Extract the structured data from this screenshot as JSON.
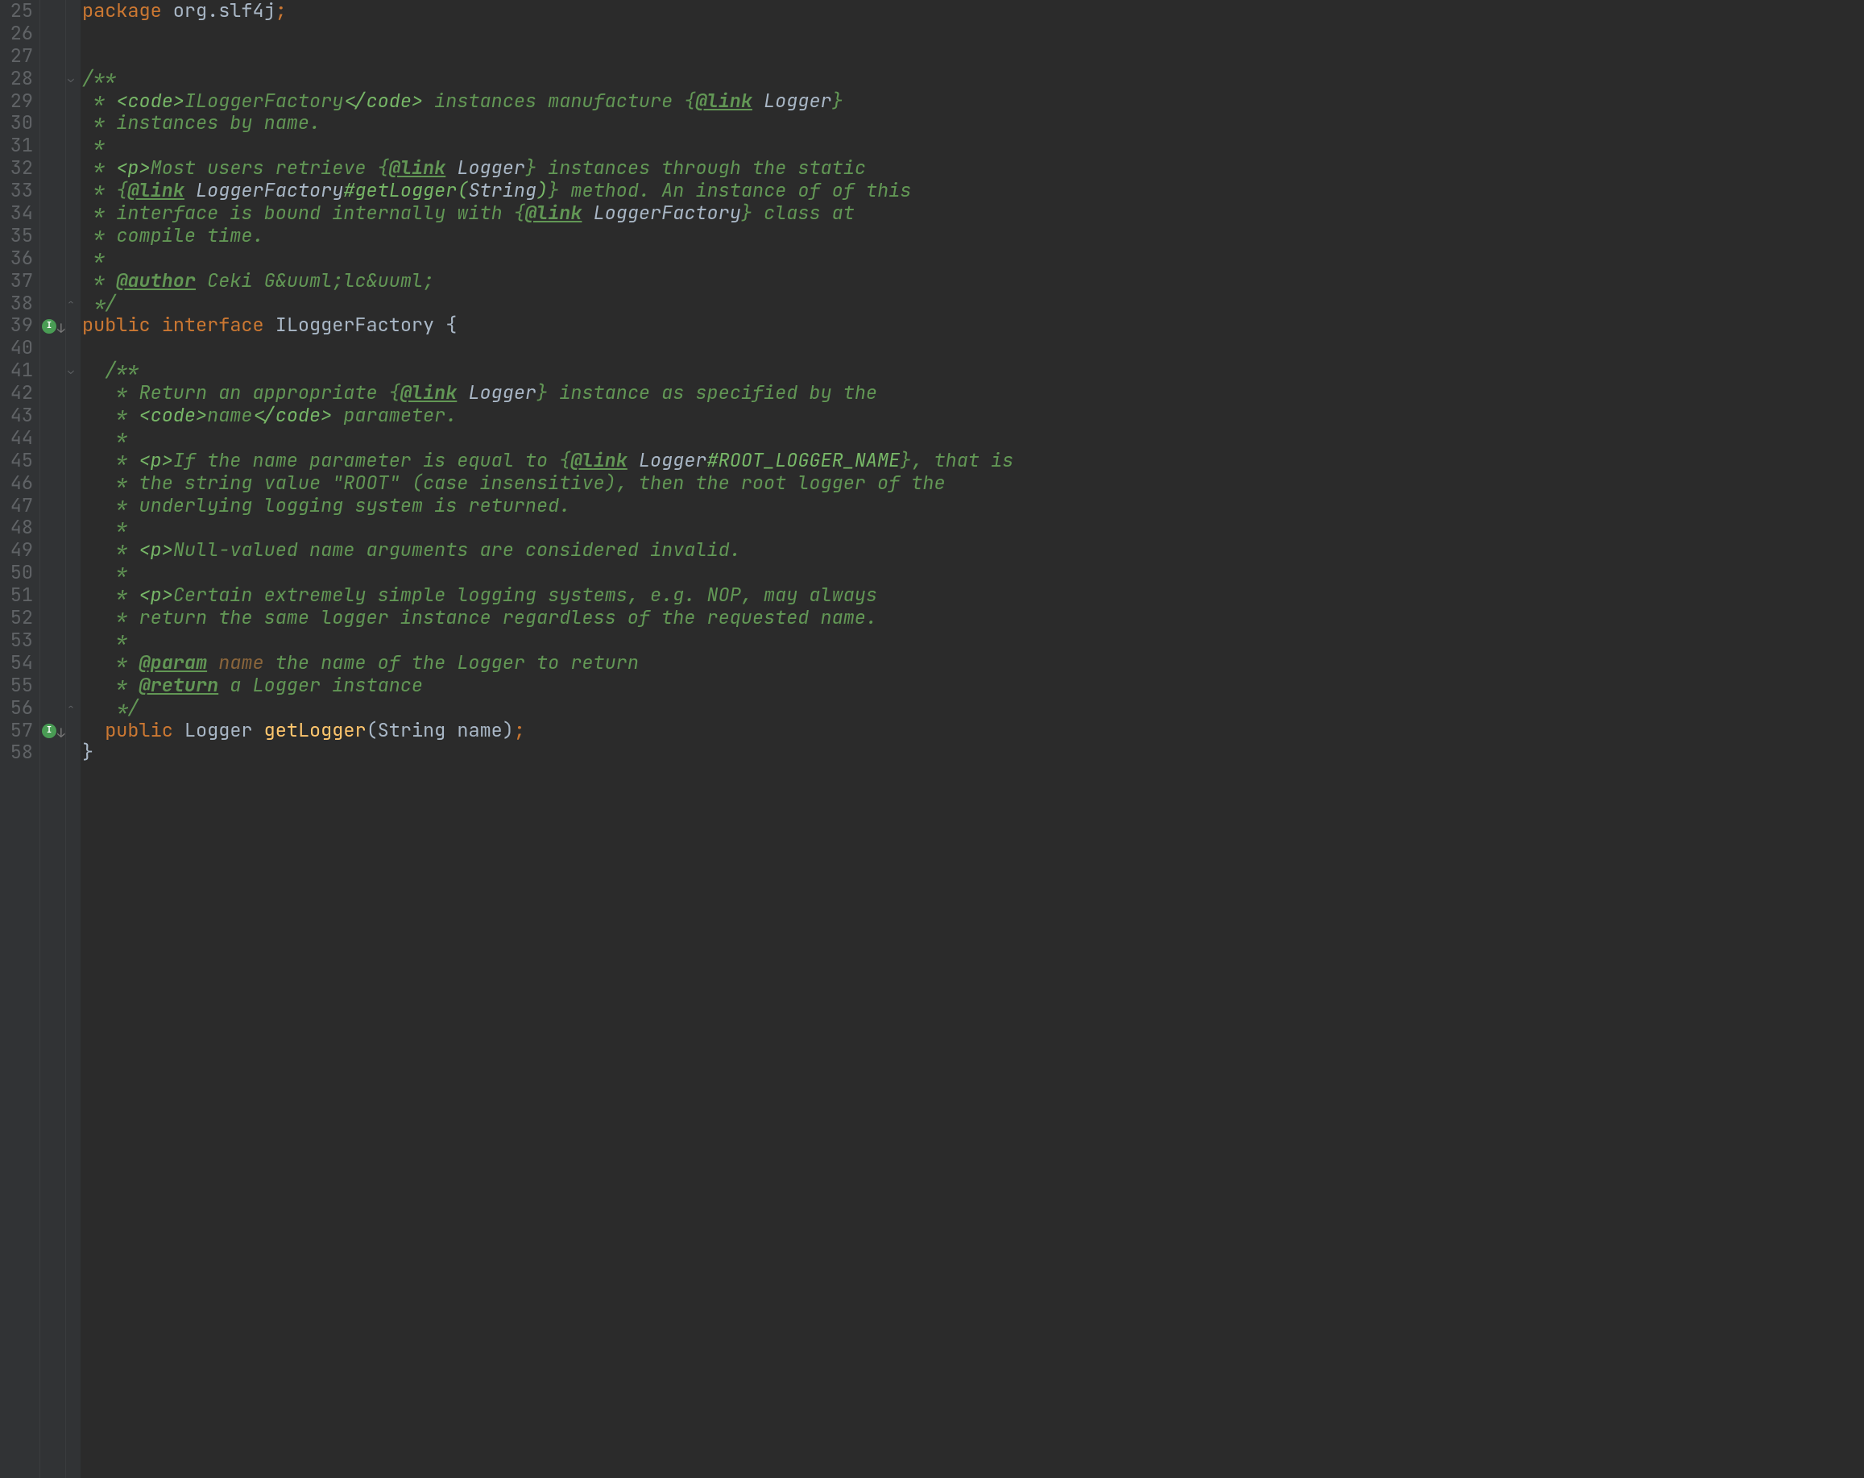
{
  "line_start": 25,
  "line_end": 58,
  "markers": [
    {
      "line": 39,
      "label": "I"
    },
    {
      "line": 57,
      "label": "I"
    }
  ],
  "folds": [
    {
      "line": 28,
      "dir": "down"
    },
    {
      "line": 38,
      "dir": "up"
    },
    {
      "line": 41,
      "dir": "down"
    },
    {
      "line": 56,
      "dir": "up"
    }
  ],
  "code": {
    "25": {
      "type": "pkg",
      "kw": "package",
      "pkg": " org.slf4j",
      "semi": ";"
    },
    "26": {
      "type": "blank"
    },
    "27": {
      "type": "blank"
    },
    "28": {
      "type": "doc-open",
      "text": "/**"
    },
    "29": {
      "type": "doc",
      "prefix": " * ",
      "segs": [
        {
          "cls": "doc-markup",
          "t": "<code>"
        },
        {
          "cls": "comment",
          "t": "ILoggerFactory"
        },
        {
          "cls": "doc-markup",
          "t": "</code>"
        },
        {
          "cls": "comment",
          "t": " instances manufacture {"
        },
        {
          "cls": "doctag",
          "t": "@link"
        },
        {
          "cls": "comment",
          "t": " "
        },
        {
          "cls": "doc-link-target",
          "t": "Logger"
        },
        {
          "cls": "comment",
          "t": "}"
        }
      ]
    },
    "30": {
      "type": "doc",
      "prefix": " * ",
      "segs": [
        {
          "cls": "comment",
          "t": "instances by name."
        }
      ]
    },
    "31": {
      "type": "doc",
      "prefix": " *",
      "segs": []
    },
    "32": {
      "type": "doc",
      "prefix": " * ",
      "segs": [
        {
          "cls": "doc-markup",
          "t": "<p>"
        },
        {
          "cls": "comment",
          "t": "Most users retrieve {"
        },
        {
          "cls": "doctag",
          "t": "@link"
        },
        {
          "cls": "comment",
          "t": " "
        },
        {
          "cls": "doc-link-target",
          "t": "Logger"
        },
        {
          "cls": "comment",
          "t": "} instances through the static"
        }
      ]
    },
    "33": {
      "type": "doc",
      "prefix": " * ",
      "segs": [
        {
          "cls": "comment",
          "t": "{"
        },
        {
          "cls": "doctag",
          "t": "@link"
        },
        {
          "cls": "comment",
          "t": " "
        },
        {
          "cls": "doc-link-target",
          "t": "LoggerFactory"
        },
        {
          "cls": "doc-link-sig",
          "t": "#getLogger("
        },
        {
          "cls": "doc-link-target",
          "t": "String"
        },
        {
          "cls": "doc-link-sig",
          "t": ")"
        },
        {
          "cls": "comment",
          "t": "} method. An instance of of this"
        }
      ]
    },
    "34": {
      "type": "doc",
      "prefix": " * ",
      "segs": [
        {
          "cls": "comment",
          "t": "interface is bound internally with {"
        },
        {
          "cls": "doctag",
          "t": "@link"
        },
        {
          "cls": "comment",
          "t": " "
        },
        {
          "cls": "doc-link-target",
          "t": "LoggerFactory"
        },
        {
          "cls": "comment",
          "t": "} class at"
        }
      ]
    },
    "35": {
      "type": "doc",
      "prefix": " * ",
      "segs": [
        {
          "cls": "comment",
          "t": "compile time."
        }
      ]
    },
    "36": {
      "type": "doc",
      "prefix": " *",
      "segs": []
    },
    "37": {
      "type": "doc",
      "prefix": " * ",
      "segs": [
        {
          "cls": "doctag",
          "t": "@author"
        },
        {
          "cls": "comment",
          "t": " Ceki G&uuml;lc&uuml;"
        }
      ]
    },
    "38": {
      "type": "doc-close",
      "text": " */"
    },
    "39": {
      "type": "decl",
      "segs": [
        {
          "cls": "kw",
          "t": "public"
        },
        {
          "cls": "",
          "t": " "
        },
        {
          "cls": "kw",
          "t": "interface"
        },
        {
          "cls": "",
          "t": " "
        },
        {
          "cls": "class-name",
          "t": "ILoggerFactory"
        },
        {
          "cls": "",
          "t": " {"
        }
      ]
    },
    "40": {
      "type": "blank"
    },
    "41": {
      "type": "doc-open-indent",
      "text": "  /**"
    },
    "42": {
      "type": "doc-indent",
      "prefix": "   * ",
      "segs": [
        {
          "cls": "comment",
          "t": "Return an appropriate {"
        },
        {
          "cls": "doctag",
          "t": "@link"
        },
        {
          "cls": "comment",
          "t": " "
        },
        {
          "cls": "doc-link-target",
          "t": "Logger"
        },
        {
          "cls": "comment",
          "t": "} instance as specified by the"
        }
      ]
    },
    "43": {
      "type": "doc-indent",
      "prefix": "   * ",
      "segs": [
        {
          "cls": "doc-markup",
          "t": "<code>"
        },
        {
          "cls": "comment",
          "t": "name"
        },
        {
          "cls": "doc-markup",
          "t": "</code>"
        },
        {
          "cls": "comment",
          "t": " parameter."
        }
      ]
    },
    "44": {
      "type": "doc-indent",
      "prefix": "   *",
      "segs": []
    },
    "45": {
      "type": "doc-indent",
      "prefix": "   * ",
      "segs": [
        {
          "cls": "doc-markup",
          "t": "<p>"
        },
        {
          "cls": "comment",
          "t": "If the name parameter is equal to {"
        },
        {
          "cls": "doctag",
          "t": "@link"
        },
        {
          "cls": "comment",
          "t": " "
        },
        {
          "cls": "doc-link-target",
          "t": "Logger"
        },
        {
          "cls": "doc-link-sig",
          "t": "#ROOT_LOGGER_NAME"
        },
        {
          "cls": "comment",
          "t": "}, that is"
        }
      ]
    },
    "46": {
      "type": "doc-indent",
      "prefix": "   * ",
      "segs": [
        {
          "cls": "comment",
          "t": "the string value \"ROOT\" (case insensitive), then the root logger of the"
        }
      ]
    },
    "47": {
      "type": "doc-indent",
      "prefix": "   * ",
      "segs": [
        {
          "cls": "comment",
          "t": "underlying logging system is returned."
        }
      ]
    },
    "48": {
      "type": "doc-indent",
      "prefix": "   *",
      "segs": []
    },
    "49": {
      "type": "doc-indent",
      "prefix": "   * ",
      "segs": [
        {
          "cls": "doc-markup",
          "t": "<p>"
        },
        {
          "cls": "comment",
          "t": "Null-valued name arguments are considered invalid."
        }
      ]
    },
    "50": {
      "type": "doc-indent",
      "prefix": "   *",
      "segs": []
    },
    "51": {
      "type": "doc-indent",
      "prefix": "   * ",
      "segs": [
        {
          "cls": "doc-markup",
          "t": "<p>"
        },
        {
          "cls": "comment",
          "t": "Certain extremely simple logging systems, e.g. NOP, may always"
        }
      ]
    },
    "52": {
      "type": "doc-indent",
      "prefix": "   * ",
      "segs": [
        {
          "cls": "comment",
          "t": "return the same logger instance regardless of the requested name."
        }
      ]
    },
    "53": {
      "type": "doc-indent",
      "prefix": "   *",
      "segs": []
    },
    "54": {
      "type": "doc-indent",
      "prefix": "   * ",
      "segs": [
        {
          "cls": "doctag",
          "t": "@param"
        },
        {
          "cls": "comment",
          "t": " "
        },
        {
          "cls": "doctag-param-name",
          "t": "name"
        },
        {
          "cls": "comment",
          "t": " the name of the Logger to return"
        }
      ]
    },
    "55": {
      "type": "doc-indent",
      "prefix": "   * ",
      "segs": [
        {
          "cls": "doctag",
          "t": "@return"
        },
        {
          "cls": "comment",
          "t": " a Logger instance"
        }
      ]
    },
    "56": {
      "type": "doc-close-indent",
      "text": "   */"
    },
    "57": {
      "type": "decl-indent",
      "segs": [
        {
          "cls": "",
          "t": "  "
        },
        {
          "cls": "kw",
          "t": "public"
        },
        {
          "cls": "",
          "t": " "
        },
        {
          "cls": "param-type",
          "t": "Logger"
        },
        {
          "cls": "",
          "t": " "
        },
        {
          "cls": "method",
          "t": "getLogger"
        },
        {
          "cls": "",
          "t": "("
        },
        {
          "cls": "param-type",
          "t": "String"
        },
        {
          "cls": "",
          "t": " "
        },
        {
          "cls": "param-name",
          "t": "name"
        },
        {
          "cls": "",
          "t": ")"
        },
        {
          "cls": "kw",
          "t": ";"
        }
      ]
    },
    "58": {
      "type": "plain",
      "text": "}"
    }
  }
}
